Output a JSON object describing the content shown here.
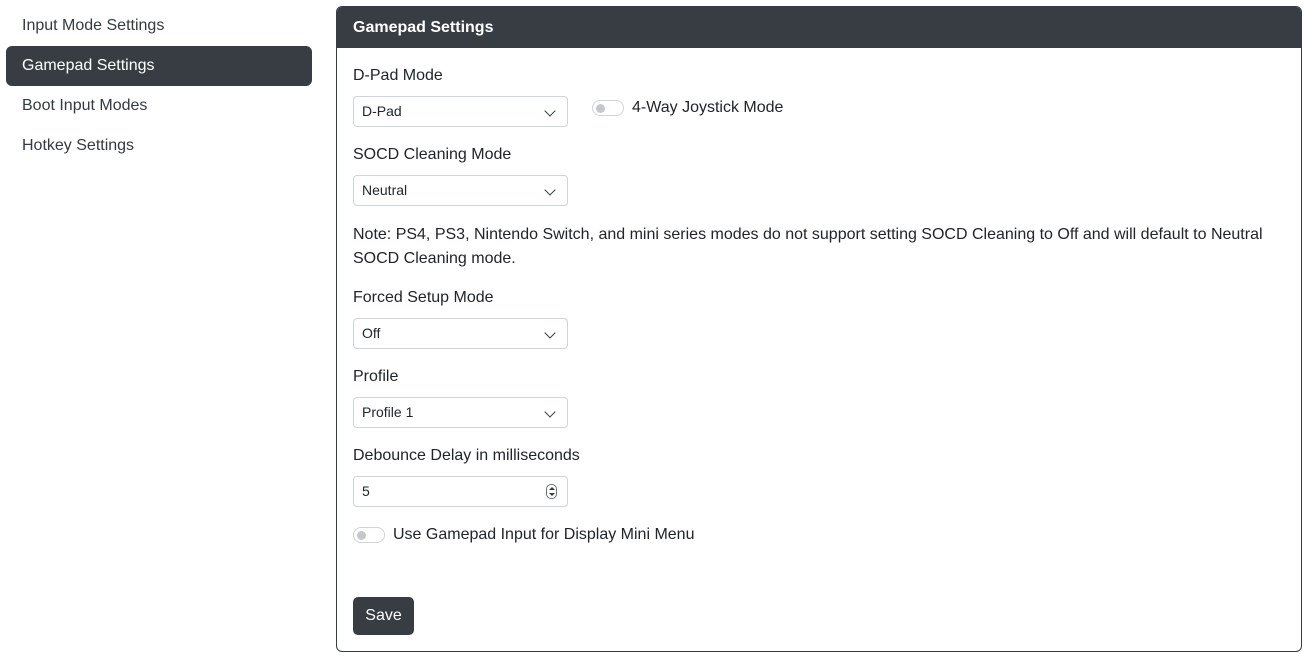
{
  "sidebar": {
    "items": [
      {
        "label": "Input Mode Settings"
      },
      {
        "label": "Gamepad Settings"
      },
      {
        "label": "Boot Input Modes"
      },
      {
        "label": "Hotkey Settings"
      }
    ]
  },
  "card": {
    "title": "Gamepad Settings",
    "dpad": {
      "label": "D-Pad Mode",
      "value": "D-Pad"
    },
    "joystick_toggle": {
      "label": "4-Way Joystick Mode",
      "checked": false
    },
    "socd": {
      "label": "SOCD Cleaning Mode",
      "value": "Neutral"
    },
    "note": "Note: PS4, PS3, Nintendo Switch, and mini series modes do not support setting SOCD Cleaning to Off and will default to Neutral SOCD Cleaning mode.",
    "forced_setup": {
      "label": "Forced Setup Mode",
      "value": "Off"
    },
    "profile": {
      "label": "Profile",
      "value": "Profile 1"
    },
    "debounce": {
      "label": "Debounce Delay in milliseconds",
      "value": "5"
    },
    "mini_menu_toggle": {
      "label": "Use Gamepad Input for Display Mini Menu",
      "checked": false
    },
    "save_label": "Save"
  },
  "colors": {
    "dark": "#383d44",
    "border": "#ced4da"
  }
}
